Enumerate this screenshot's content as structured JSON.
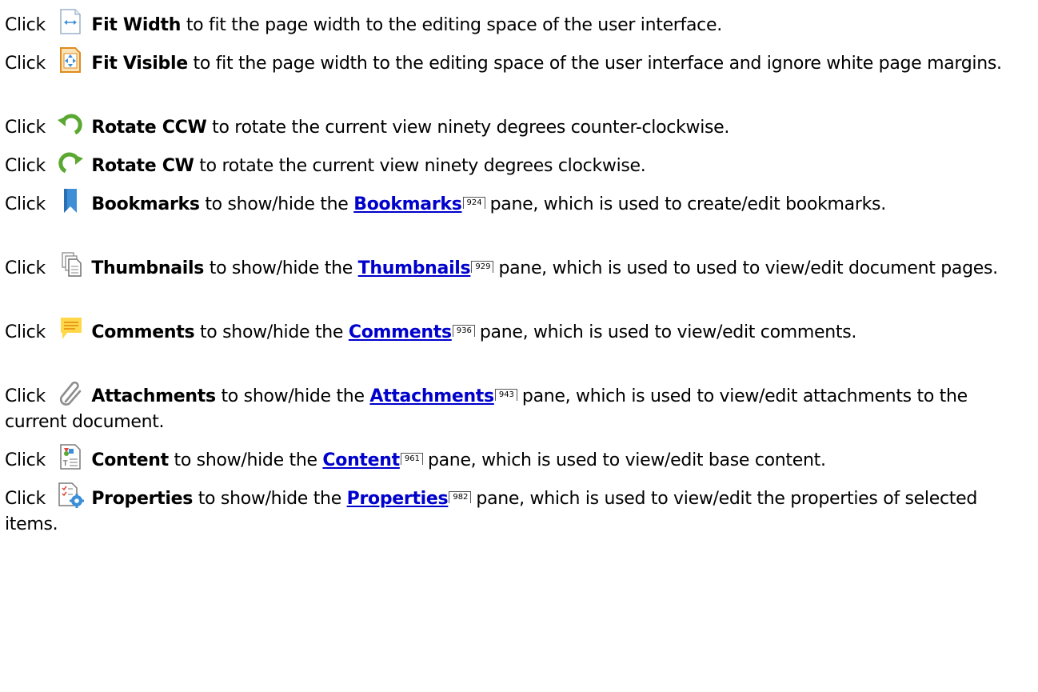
{
  "items": [
    {
      "click": "Click",
      "name": "Fit Width",
      "rest": "to fit the page width to the editing space of the user interface."
    },
    {
      "click": "Click",
      "name": "Fit Visible",
      "rest": "to fit the page width to the editing space of the user interface and ignore white page margins."
    },
    {
      "click": "Click",
      "name": "Rotate CCW",
      "rest": " to rotate the current view ninety degrees counter-clockwise."
    },
    {
      "click": "Click",
      "name": "Rotate CW",
      "rest": " to rotate the current view ninety degrees clockwise."
    },
    {
      "click": "Click",
      "name": "Bookmarks",
      "pre": "to show/hide the",
      "link": "Bookmarks",
      "page": "924",
      "post": "pane, which is used to create/edit bookmarks."
    },
    {
      "click": "Click",
      "name": "Thumbnails",
      "pre": "to show/hide the",
      "link": "Thumbnails",
      "page": "929",
      "post": "pane, which is used to used to view/edit document pages."
    },
    {
      "click": "Click",
      "name": "Comments",
      "pre": "to show/hide the",
      "link": "Comments",
      "page": "936",
      "post": "pane, which is used to view/edit comments."
    },
    {
      "click": "Click",
      "name": "Attachments",
      "pre": "to show/hide the",
      "link": "Attachments",
      "page": "943",
      "post": "pane, which is used to view/edit attachments to the current document."
    },
    {
      "click": "Click",
      "name": "Content",
      "pre": "to show/hide the",
      "link": "Content",
      "page": "961",
      "post": "pane, which is used to view/edit base content."
    },
    {
      "click": "Click",
      "name": "Properties",
      "pre": "to show/hide the",
      "link": "Properties",
      "page": "982",
      "post": "pane, which is used to view/edit the properties of selected items."
    }
  ],
  "icons": [
    "fit-width-icon",
    "fit-visible-icon",
    "rotate-ccw-icon",
    "rotate-cw-icon",
    "bookmarks-icon",
    "thumbnails-icon",
    "comments-icon",
    "attachments-icon",
    "content-icon",
    "properties-icon"
  ],
  "colors": {
    "link": "#0000cc",
    "text": "#000000",
    "background": "#ffffff"
  }
}
